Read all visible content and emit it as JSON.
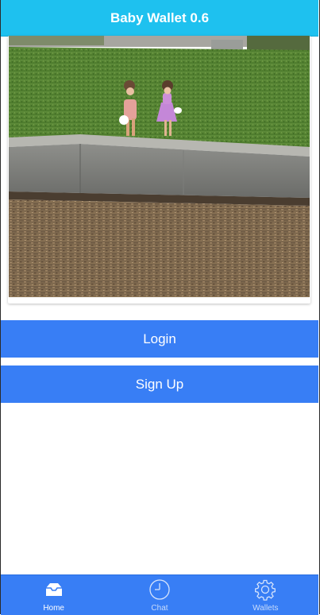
{
  "header": {
    "title": "Baby Wallet 0.6"
  },
  "hero": {
    "image": "two-children-on-playground-wall"
  },
  "buttons": {
    "login_label": "Login",
    "signup_label": "Sign Up"
  },
  "tabs": [
    {
      "label": "Home",
      "icon": "inbox-icon",
      "active": true
    },
    {
      "label": "Chat",
      "icon": "clock-icon",
      "active": false
    },
    {
      "label": "Wallets",
      "icon": "gear-icon",
      "active": false
    }
  ],
  "colors": {
    "header": "#1ec1ef",
    "primary": "#387ef5",
    "tab_inactive_text": "#c9dcfb"
  }
}
